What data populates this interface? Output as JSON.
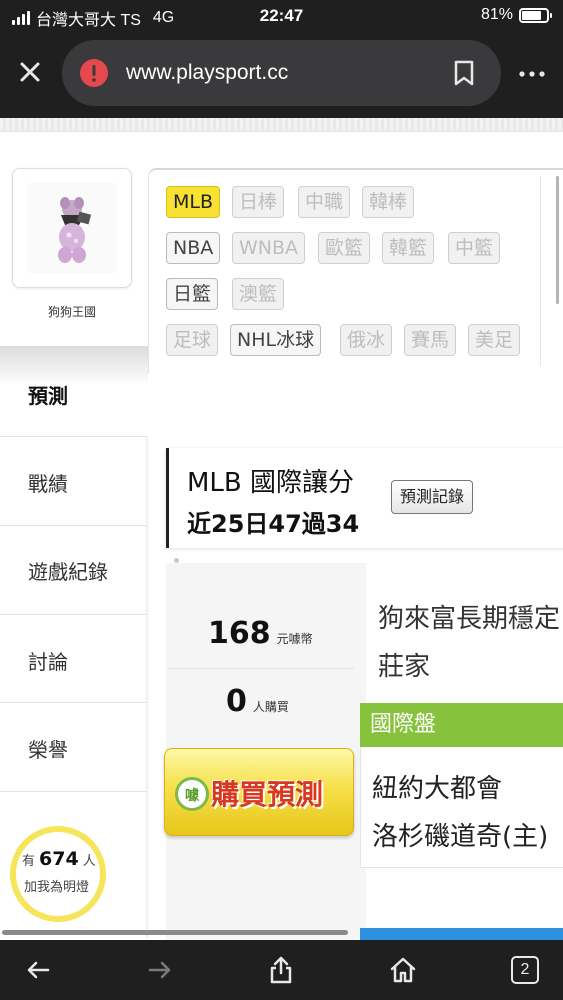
{
  "status_bar": {
    "carrier": "台灣大哥大 TS",
    "network": "4G",
    "time": "22:47",
    "battery": "81%",
    "battery_level": 0.81
  },
  "browser": {
    "url": "www.playsport.cc",
    "tab_count": "2"
  },
  "profile": {
    "name": "狗狗王國"
  },
  "sports": {
    "row1": [
      "MLB",
      "日棒",
      "中職",
      "韓棒"
    ],
    "row2": [
      "NBA",
      "WNBA",
      "歐籃",
      "韓籃",
      "中籃"
    ],
    "row3": [
      "日籃",
      "澳籃"
    ],
    "row4": [
      "足球",
      "NHL冰球",
      "俄冰",
      "賽馬",
      "美足"
    ],
    "selected": "MLB"
  },
  "menu": {
    "predict": "預測",
    "record": "戰績",
    "game_log": "遊戲紀錄",
    "discuss": "討論",
    "honor": "榮譽"
  },
  "fans": {
    "prefix": "有",
    "count": "674",
    "suffix": "人",
    "line2": "加我為明燈"
  },
  "prediction": {
    "title": "MLB 國際讓分",
    "summary": "近25日47過34",
    "record_button": "預測記錄",
    "price": "168",
    "price_unit": "元噱幣",
    "buyers": "0",
    "buyers_unit": "人購買",
    "buy_button": "購買預測",
    "buy_icon_text": "噱",
    "analysis_title": "狗來富長期穩定",
    "analysis_sub": "莊家",
    "market": "國際盤",
    "team_home": "紐約大都會",
    "team_away": "洛杉磯道奇(主)"
  }
}
